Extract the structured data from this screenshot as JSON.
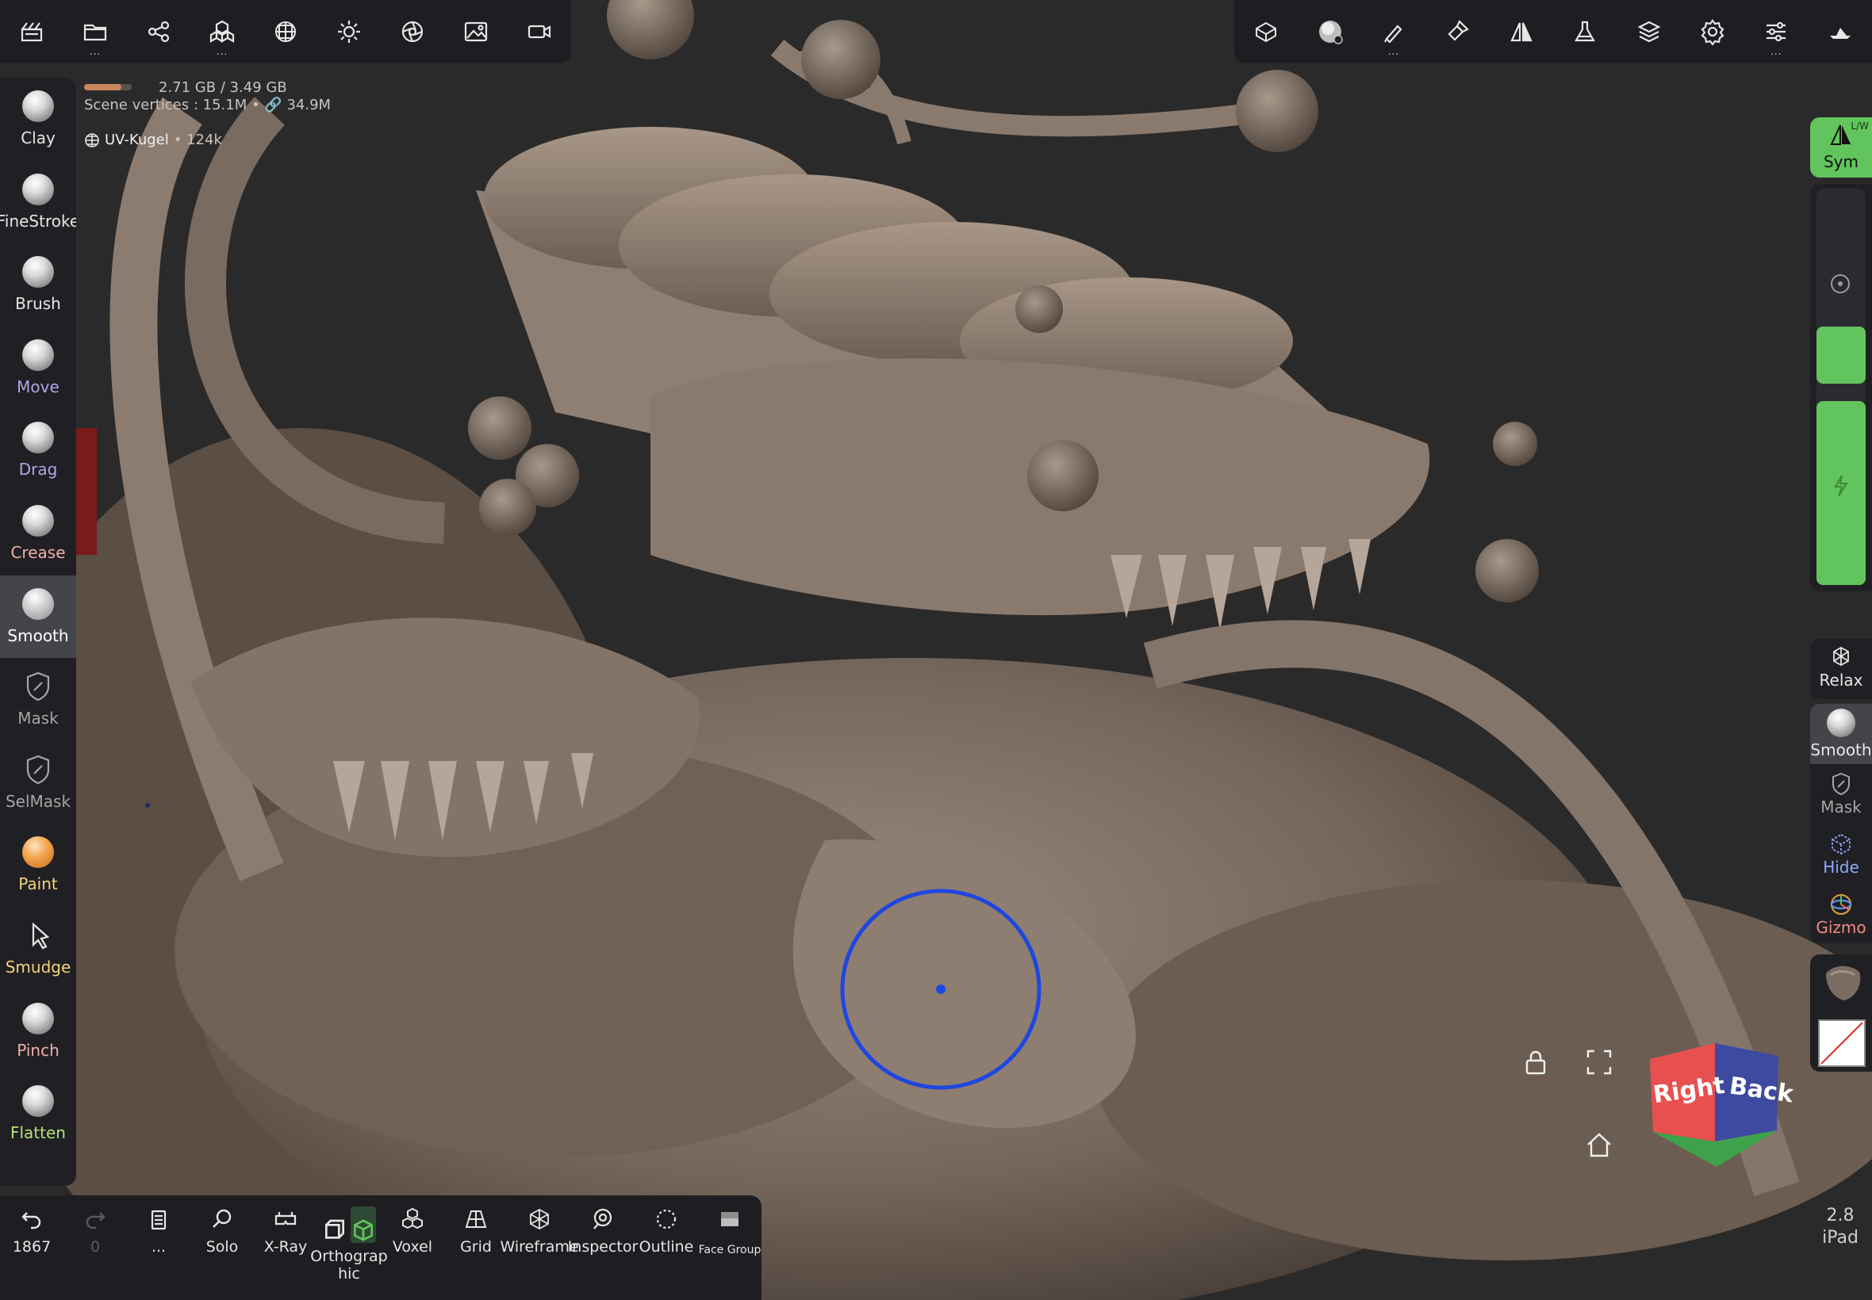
{
  "top_left_toolbar": {
    "items": [
      {
        "icon": "scene-icon"
      },
      {
        "icon": "folder-icon"
      },
      {
        "icon": "share-icon"
      },
      {
        "icon": "primitives-icon"
      },
      {
        "icon": "material-icon"
      },
      {
        "icon": "light-icon"
      },
      {
        "icon": "postprocess-icon"
      },
      {
        "icon": "background-image-icon"
      },
      {
        "icon": "camera-icon"
      }
    ]
  },
  "top_right_toolbar": {
    "items": [
      {
        "icon": "topology-icon"
      },
      {
        "icon": "smooth-brush-icon"
      },
      {
        "icon": "stroke-icon"
      },
      {
        "icon": "painting-icon"
      },
      {
        "icon": "symmetry-icon"
      },
      {
        "icon": "flask-icon"
      },
      {
        "icon": "layers-icon"
      },
      {
        "icon": "settings-icon"
      },
      {
        "icon": "sliders-icon"
      },
      {
        "icon": "interface-icon"
      }
    ]
  },
  "info": {
    "memory": "2.71 GB / 3.49 GB",
    "memory_fraction": 0.78,
    "vertices_label": "Scene vertices : 15.1M • ",
    "vertices_total": "34.9M",
    "object_name": "UV-Kugel",
    "object_count": "• 124k"
  },
  "left_tools": [
    {
      "label": "Clay",
      "color": "#e6e6e6"
    },
    {
      "label": "FineStroke",
      "color": "#e6e6e6"
    },
    {
      "label": "Brush",
      "color": "#e6e6e6"
    },
    {
      "label": "Move",
      "color": "#b0a6e8"
    },
    {
      "label": "Drag",
      "color": "#b0a6e8"
    },
    {
      "label": "Crease",
      "color": "#f0b0a8"
    },
    {
      "label": "Smooth",
      "color": "#ffffff"
    },
    {
      "label": "Mask",
      "color": "#a5a5a5"
    },
    {
      "label": "SelMask",
      "color": "#a5a5a5"
    },
    {
      "label": "Paint",
      "color": "#f2d27a"
    },
    {
      "label": "Smudge",
      "color": "#f2d27a"
    },
    {
      "label": "Pinch",
      "color": "#f0b0a8"
    },
    {
      "label": "Flatten",
      "color": "#b8e07a"
    }
  ],
  "right_panel": {
    "sym": {
      "label": "Sym",
      "badge": "L/W"
    },
    "relax": "Relax",
    "smooth": "Smooth",
    "mask": "Mask",
    "hide": "Hide",
    "gizmo": "Gizmo"
  },
  "nav_cube": {
    "right": "Right",
    "back": "Back"
  },
  "version": {
    "number": "2.8",
    "device": "iPad"
  },
  "bottom_toolbar": {
    "undo": {
      "label": "1867"
    },
    "redo": {
      "label": "0"
    },
    "more": {
      "label": "..."
    },
    "solo": {
      "label": "Solo"
    },
    "xray": {
      "label": "X-Ray"
    },
    "ortho": {
      "label_1": "Orthograp",
      "label_2": "hic"
    },
    "voxel": {
      "label": "Voxel"
    },
    "grid": {
      "label": "Grid"
    },
    "wireframe": {
      "label": "Wireframe"
    },
    "inspector": {
      "label": "Inspector"
    },
    "outline": {
      "label": "Outline"
    },
    "facegroup": {
      "label": "Face Group"
    }
  },
  "colors": {
    "bar_bg": "#1e1e22",
    "accent_green": "#62c45c",
    "brush_circle": "#1f46e0",
    "cube_red": "#e8504f",
    "cube_blue": "#3d4aa0",
    "cube_green": "#3fa24a",
    "model": "#7d6d61"
  }
}
